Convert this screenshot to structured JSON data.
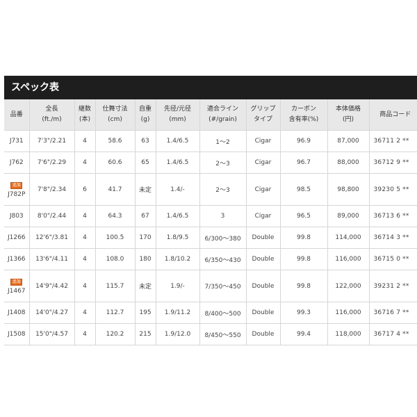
{
  "title": "スペック表",
  "headers": [
    [
      "品番"
    ],
    [
      "全長",
      "(ft./m)"
    ],
    [
      "継数",
      "(本)"
    ],
    [
      "仕舞寸法",
      "(cm)"
    ],
    [
      "自重",
      "(g)"
    ],
    [
      "先径/元径",
      "(mm)"
    ],
    [
      "適合ライン",
      "(#/grain)"
    ],
    [
      "グリップ",
      "タイプ"
    ],
    [
      "カーボン",
      "含有率(%)"
    ],
    [
      "本体価格",
      "(円)"
    ],
    [
      "商品コード"
    ]
  ],
  "rows": [
    {
      "badge": "",
      "cells": [
        "J731",
        "7'3\"/2.21",
        "4",
        "58.6",
        "63",
        "1.4/6.5",
        "1〜2",
        "Cigar",
        "96.9",
        "87,000",
        "36711 2 **"
      ]
    },
    {
      "badge": "",
      "cells": [
        "J762",
        "7'6\"/2.29",
        "4",
        "60.6",
        "65",
        "1.4/6.5",
        "2〜3",
        "Cigar",
        "96.7",
        "88,000",
        "36712 9 **"
      ]
    },
    {
      "badge": "追加",
      "cells": [
        "J782P",
        "7'8\"/2.34",
        "6",
        "41.7",
        "未定",
        "1.4/-",
        "2〜3",
        "Cigar",
        "98.5",
        "98,800",
        "39230 5 **"
      ]
    },
    {
      "badge": "",
      "cells": [
        "J803",
        "8'0\"/2.44",
        "4",
        "64.3",
        "67",
        "1.4/6.5",
        "3",
        "Cigar",
        "96.5",
        "89,000",
        "36713 6 **"
      ]
    },
    {
      "badge": "",
      "cells": [
        "J1266",
        "12'6\"/3.81",
        "4",
        "100.5",
        "170",
        "1.8/9.5",
        "6/300〜380",
        "Double",
        "99.8",
        "114,000",
        "36714 3 **"
      ]
    },
    {
      "badge": "",
      "cells": [
        "J1366",
        "13'6\"/4.11",
        "4",
        "108.0",
        "180",
        "1.8/10.2",
        "6/350〜430",
        "Double",
        "99.8",
        "116,000",
        "36715 0 **"
      ]
    },
    {
      "badge": "追加",
      "cells": [
        "J1467",
        "14'9\"/4.42",
        "4",
        "115.7",
        "未定",
        "1.9/-",
        "7/350〜450",
        "Double",
        "99.8",
        "122,000",
        "39231 2 **"
      ]
    },
    {
      "badge": "",
      "cells": [
        "J1408",
        "14'0\"/4.27",
        "4",
        "112.7",
        "195",
        "1.9/11.2",
        "8/400〜500",
        "Double",
        "99.3",
        "116,000",
        "36716 7 **"
      ]
    },
    {
      "badge": "",
      "cells": [
        "J1508",
        "15'0\"/4.57",
        "4",
        "120.2",
        "215",
        "1.9/12.0",
        "8/450〜550",
        "Double",
        "99.4",
        "118,000",
        "36717 4 **"
      ]
    }
  ]
}
